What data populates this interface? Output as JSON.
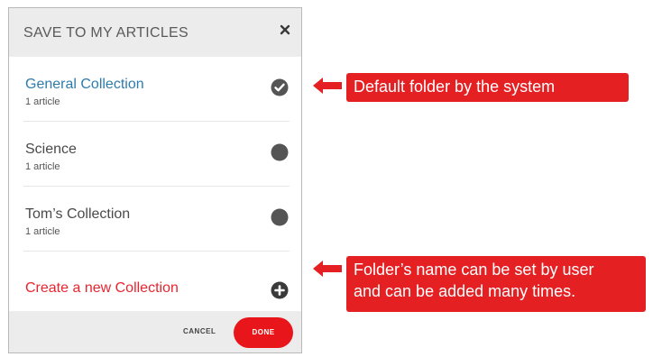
{
  "dialog": {
    "title": "SAVE TO MY ARTICLES",
    "close_icon": "close-icon",
    "collections": [
      {
        "name": "General Collection",
        "count": "1 article",
        "selected": true,
        "icon": "check-circle-icon"
      },
      {
        "name": "Science",
        "count": "1 article",
        "selected": false,
        "icon": "circle-icon"
      },
      {
        "name": "Tom’s Collection",
        "count": "1 article",
        "selected": false,
        "icon": "circle-icon"
      }
    ],
    "create": {
      "label": "Create a new Collection",
      "icon": "plus-circle-icon"
    },
    "footer": {
      "cancel_label": "CANCEL",
      "done_label": "DONE"
    }
  },
  "annotations": [
    {
      "lines": [
        "Default folder by the system"
      ],
      "icon": "arrow-left-icon"
    },
    {
      "lines": [
        "Folder’s name can be set by user",
        "and can be added many times."
      ],
      "icon": "arrow-left-icon"
    }
  ],
  "colors": {
    "selected_link": "#2f7cac",
    "create_link": "#e8252f",
    "done_button": "#e8161b",
    "annotation_bg": "#e42023",
    "toggle_gray": "#555555"
  }
}
